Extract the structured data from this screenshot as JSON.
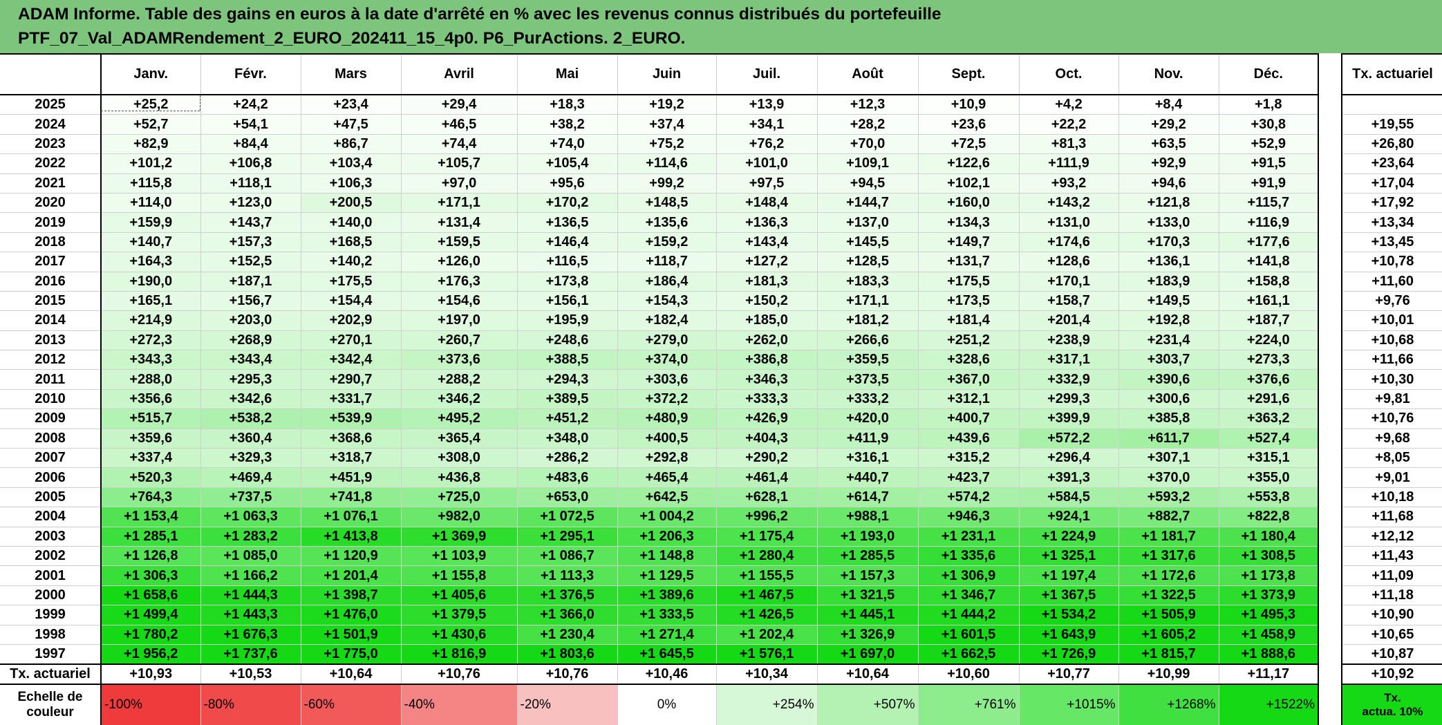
{
  "title": {
    "line1": "ADAM Informe. Table des gains en euros à la date d'arrêté en % avec les revenus connus distribués du portefeuille",
    "line2": "PTF_07_Val_ADAMRendement_2_EURO_202411_15_4p0. P6_PurActions. 2_EURO."
  },
  "months": [
    "Janv.",
    "Févr.",
    "Mars",
    "Avril",
    "Mai",
    "Juin",
    "Juil.",
    "Août",
    "Sept.",
    "Oct.",
    "Nov.",
    "Déc."
  ],
  "side_header": "Tx. actuariel",
  "rows": [
    {
      "year": "2025",
      "values": [
        "+25,2",
        "+24,2",
        "+23,4",
        "+29,4",
        "+18,3",
        "+19,2",
        "+13,9",
        "+12,3",
        "+10,9",
        "+4,2",
        "+8,4",
        "+1,8"
      ],
      "tx": ""
    },
    {
      "year": "2024",
      "values": [
        "+52,7",
        "+54,1",
        "+47,5",
        "+46,5",
        "+38,2",
        "+37,4",
        "+34,1",
        "+28,2",
        "+23,6",
        "+22,2",
        "+29,2",
        "+30,8"
      ],
      "tx": "+19,55"
    },
    {
      "year": "2023",
      "values": [
        "+82,9",
        "+84,4",
        "+86,7",
        "+74,4",
        "+74,0",
        "+75,2",
        "+76,2",
        "+70,0",
        "+72,5",
        "+81,3",
        "+63,5",
        "+52,9"
      ],
      "tx": "+26,80"
    },
    {
      "year": "2022",
      "values": [
        "+101,2",
        "+106,8",
        "+103,4",
        "+105,7",
        "+105,4",
        "+114,6",
        "+101,0",
        "+109,1",
        "+122,6",
        "+111,9",
        "+92,9",
        "+91,5"
      ],
      "tx": "+23,64"
    },
    {
      "year": "2021",
      "values": [
        "+115,8",
        "+118,1",
        "+106,3",
        "+97,0",
        "+95,6",
        "+99,2",
        "+97,5",
        "+94,5",
        "+102,1",
        "+93,2",
        "+94,6",
        "+91,9"
      ],
      "tx": "+17,04"
    },
    {
      "year": "2020",
      "values": [
        "+114,0",
        "+123,0",
        "+200,5",
        "+171,1",
        "+170,2",
        "+148,5",
        "+148,4",
        "+144,7",
        "+160,0",
        "+143,2",
        "+121,8",
        "+115,7"
      ],
      "tx": "+17,92"
    },
    {
      "year": "2019",
      "values": [
        "+159,9",
        "+143,7",
        "+140,0",
        "+131,4",
        "+136,5",
        "+135,6",
        "+136,3",
        "+137,0",
        "+134,3",
        "+131,0",
        "+133,0",
        "+116,9"
      ],
      "tx": "+13,34"
    },
    {
      "year": "2018",
      "values": [
        "+140,7",
        "+157,3",
        "+168,5",
        "+159,5",
        "+146,4",
        "+159,2",
        "+143,4",
        "+145,5",
        "+149,7",
        "+174,6",
        "+170,3",
        "+177,6"
      ],
      "tx": "+13,45"
    },
    {
      "year": "2017",
      "values": [
        "+164,3",
        "+152,5",
        "+140,2",
        "+126,0",
        "+116,5",
        "+118,7",
        "+127,2",
        "+128,5",
        "+131,7",
        "+128,6",
        "+136,1",
        "+141,8"
      ],
      "tx": "+10,78"
    },
    {
      "year": "2016",
      "values": [
        "+190,0",
        "+187,1",
        "+175,5",
        "+176,3",
        "+173,8",
        "+186,4",
        "+181,3",
        "+183,3",
        "+175,5",
        "+170,1",
        "+183,9",
        "+158,8"
      ],
      "tx": "+11,60"
    },
    {
      "year": "2015",
      "values": [
        "+165,1",
        "+156,7",
        "+154,4",
        "+154,6",
        "+156,1",
        "+154,3",
        "+150,2",
        "+171,1",
        "+173,5",
        "+158,7",
        "+149,5",
        "+161,1"
      ],
      "tx": "+9,76"
    },
    {
      "year": "2014",
      "values": [
        "+214,9",
        "+203,0",
        "+202,9",
        "+197,0",
        "+195,9",
        "+182,4",
        "+185,0",
        "+181,2",
        "+181,4",
        "+201,4",
        "+192,8",
        "+187,7"
      ],
      "tx": "+10,01"
    },
    {
      "year": "2013",
      "values": [
        "+272,3",
        "+268,9",
        "+270,1",
        "+260,7",
        "+248,6",
        "+279,0",
        "+262,0",
        "+266,6",
        "+251,2",
        "+238,9",
        "+231,4",
        "+224,0"
      ],
      "tx": "+10,68"
    },
    {
      "year": "2012",
      "values": [
        "+343,3",
        "+343,4",
        "+342,4",
        "+373,6",
        "+388,5",
        "+374,0",
        "+386,8",
        "+359,5",
        "+328,6",
        "+317,1",
        "+303,7",
        "+273,3"
      ],
      "tx": "+11,66"
    },
    {
      "year": "2011",
      "values": [
        "+288,0",
        "+295,3",
        "+290,7",
        "+288,2",
        "+294,3",
        "+303,6",
        "+346,3",
        "+373,5",
        "+367,0",
        "+332,9",
        "+390,6",
        "+376,6"
      ],
      "tx": "+10,30"
    },
    {
      "year": "2010",
      "values": [
        "+356,6",
        "+342,6",
        "+331,7",
        "+346,2",
        "+389,5",
        "+372,2",
        "+333,3",
        "+333,2",
        "+312,1",
        "+299,3",
        "+300,6",
        "+291,6"
      ],
      "tx": "+9,81"
    },
    {
      "year": "2009",
      "values": [
        "+515,7",
        "+538,2",
        "+539,9",
        "+495,2",
        "+451,2",
        "+480,9",
        "+426,9",
        "+420,0",
        "+400,7",
        "+399,9",
        "+385,8",
        "+363,2"
      ],
      "tx": "+10,76"
    },
    {
      "year": "2008",
      "values": [
        "+359,6",
        "+360,4",
        "+368,6",
        "+365,4",
        "+348,0",
        "+400,5",
        "+404,3",
        "+411,9",
        "+439,6",
        "+572,2",
        "+611,7",
        "+527,4"
      ],
      "tx": "+9,68"
    },
    {
      "year": "2007",
      "values": [
        "+337,4",
        "+329,3",
        "+318,7",
        "+308,0",
        "+286,2",
        "+292,8",
        "+290,2",
        "+316,1",
        "+315,2",
        "+296,4",
        "+307,1",
        "+315,1"
      ],
      "tx": "+8,05"
    },
    {
      "year": "2006",
      "values": [
        "+520,3",
        "+469,4",
        "+451,9",
        "+436,8",
        "+483,6",
        "+465,4",
        "+461,4",
        "+440,7",
        "+423,7",
        "+391,3",
        "+370,0",
        "+355,0"
      ],
      "tx": "+9,01"
    },
    {
      "year": "2005",
      "values": [
        "+764,3",
        "+737,5",
        "+741,8",
        "+725,0",
        "+653,0",
        "+642,5",
        "+628,1",
        "+614,7",
        "+574,2",
        "+584,5",
        "+593,2",
        "+553,8"
      ],
      "tx": "+10,18"
    },
    {
      "year": "2004",
      "values": [
        "+1 153,4",
        "+1 063,3",
        "+1 076,1",
        "+982,0",
        "+1 072,5",
        "+1 004,2",
        "+996,2",
        "+988,1",
        "+946,3",
        "+924,1",
        "+882,7",
        "+822,8"
      ],
      "tx": "+11,68"
    },
    {
      "year": "2003",
      "values": [
        "+1 285,1",
        "+1 283,2",
        "+1 413,8",
        "+1 369,9",
        "+1 295,1",
        "+1 206,3",
        "+1 175,4",
        "+1 193,0",
        "+1 231,1",
        "+1 224,9",
        "+1 181,7",
        "+1 180,4"
      ],
      "tx": "+12,12"
    },
    {
      "year": "2002",
      "values": [
        "+1 126,8",
        "+1 085,0",
        "+1 120,9",
        "+1 103,9",
        "+1 086,7",
        "+1 148,8",
        "+1 280,4",
        "+1 285,5",
        "+1 335,6",
        "+1 325,1",
        "+1 317,6",
        "+1 308,5"
      ],
      "tx": "+11,43"
    },
    {
      "year": "2001",
      "values": [
        "+1 306,3",
        "+1 166,2",
        "+1 201,4",
        "+1 155,8",
        "+1 113,3",
        "+1 129,5",
        "+1 155,5",
        "+1 157,3",
        "+1 306,9",
        "+1 197,4",
        "+1 172,6",
        "+1 173,8"
      ],
      "tx": "+11,09"
    },
    {
      "year": "2000",
      "values": [
        "+1 658,6",
        "+1 444,3",
        "+1 398,7",
        "+1 405,6",
        "+1 376,5",
        "+1 389,6",
        "+1 467,5",
        "+1 321,5",
        "+1 346,7",
        "+1 367,5",
        "+1 322,5",
        "+1 373,9"
      ],
      "tx": "+11,18"
    },
    {
      "year": "1999",
      "values": [
        "+1 499,4",
        "+1 443,3",
        "+1 476,0",
        "+1 379,5",
        "+1 366,0",
        "+1 333,5",
        "+1 426,5",
        "+1 445,1",
        "+1 444,2",
        "+1 534,2",
        "+1 505,9",
        "+1 495,3"
      ],
      "tx": "+10,90"
    },
    {
      "year": "1998",
      "values": [
        "+1 780,2",
        "+1 676,3",
        "+1 501,9",
        "+1 430,6",
        "+1 230,4",
        "+1 271,4",
        "+1 202,4",
        "+1 326,9",
        "+1 601,5",
        "+1 643,9",
        "+1 605,2",
        "+1 458,9"
      ],
      "tx": "+10,65"
    },
    {
      "year": "1997",
      "values": [
        "+1 956,2",
        "+1 737,6",
        "+1 775,0",
        "+1 816,9",
        "+1 803,6",
        "+1 645,5",
        "+1 576,1",
        "+1 697,0",
        "+1 662,5",
        "+1 726,9",
        "+1 815,7",
        "+1 888,6"
      ],
      "tx": "+10,87"
    }
  ],
  "tx_row": {
    "label": "Tx. actuariel",
    "values": [
      "+10,93",
      "+10,53",
      "+10,64",
      "+10,76",
      "+10,76",
      "+10,46",
      "+10,34",
      "+10,64",
      "+10,60",
      "+10,77",
      "+10,99",
      "+11,17"
    ],
    "total": "+10,92"
  },
  "scale": {
    "label_line1": "Echelle de",
    "label_line2": "couleur",
    "items": [
      {
        "text": "-100%",
        "color": "#ef3b3b"
      },
      {
        "text": "-80%",
        "color": "#f14a4a"
      },
      {
        "text": "-60%",
        "color": "#f25a5a"
      },
      {
        "text": "-40%",
        "color": "#f58585"
      },
      {
        "text": "-20%",
        "color": "#f9c0c0"
      },
      {
        "text": "0%",
        "color": "#ffffff"
      },
      {
        "text": "+254%",
        "color": "#d6f8d6"
      },
      {
        "text": "+507%",
        "color": "#b3f2b3"
      },
      {
        "text": "+761%",
        "color": "#8ded8d"
      },
      {
        "text": "+1015%",
        "color": "#66e766"
      },
      {
        "text": "+1268%",
        "color": "#3fe03f"
      },
      {
        "text": "+1522%",
        "color": "#14d914"
      }
    ],
    "side_line1": "Tx.",
    "side_line2": "actua. 10%",
    "side_color": "#14d914"
  },
  "colors": {
    "title_bg": "#7dc57d",
    "scale_max_value": 1522
  }
}
